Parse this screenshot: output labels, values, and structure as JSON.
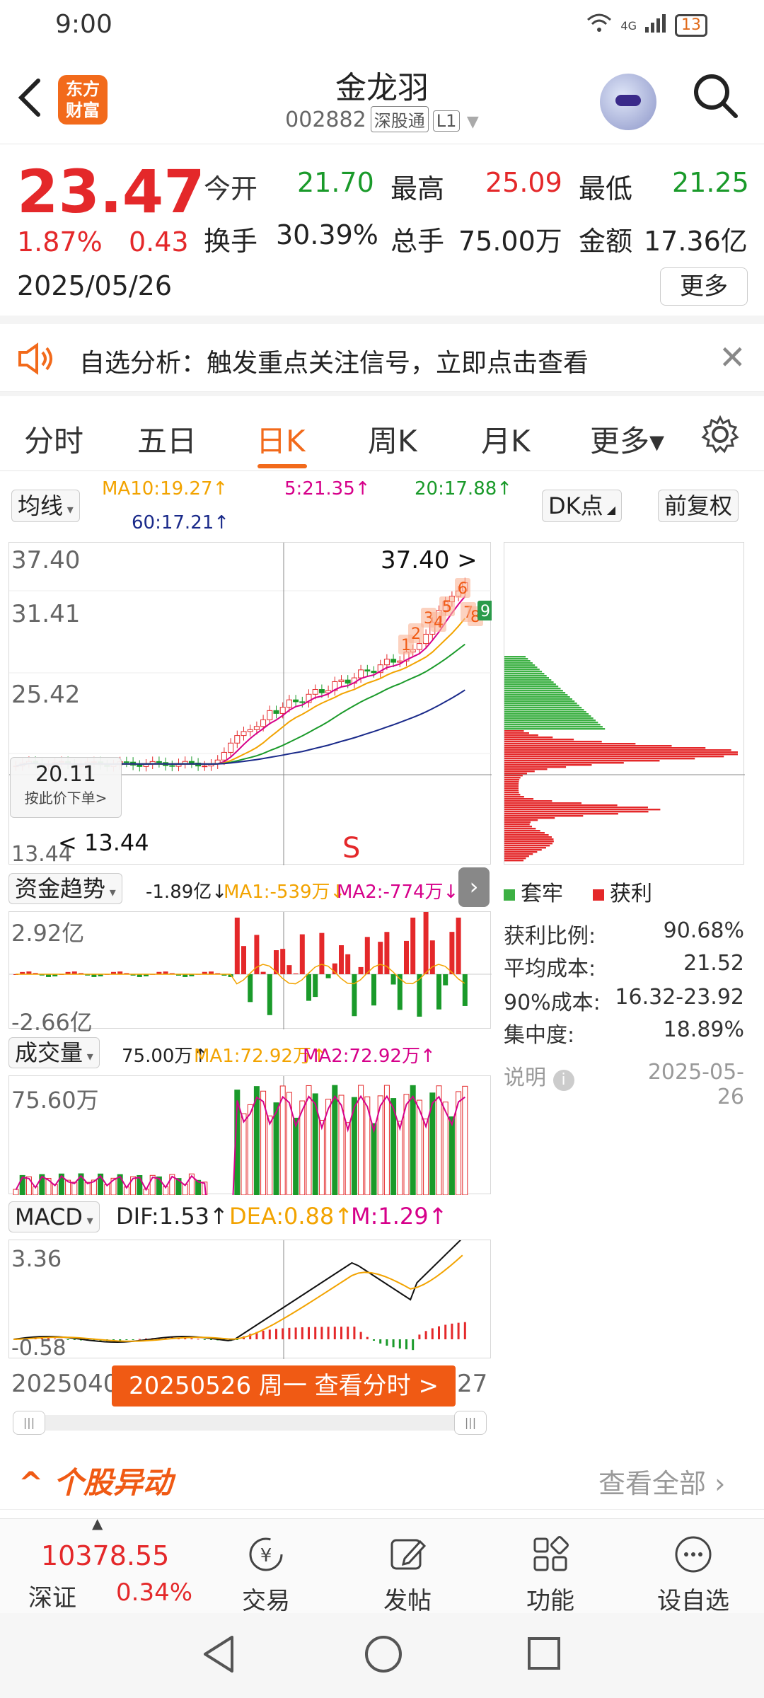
{
  "status": {
    "time": "9:00",
    "network": "4G",
    "battery": "13"
  },
  "header": {
    "title": "金龙羽",
    "code": "002882",
    "tag1": "深股通",
    "tag2": "L1",
    "logo": "东方\n财富"
  },
  "quote": {
    "price": "23.47",
    "change_pct": "1.87%",
    "change": "0.43",
    "date": "2025/05/26",
    "open_label": "今开",
    "open": "21.70",
    "high_label": "最高",
    "high": "25.09",
    "low_label": "最低",
    "low": "21.25",
    "turnover_label": "换手",
    "turnover": "30.39%",
    "volume_label": "总手",
    "volume": "75.00万",
    "amount_label": "金额",
    "amount": "17.36亿",
    "more": "更多"
  },
  "notice": {
    "text": "自选分析：触发重点关注信号，立即点击查看"
  },
  "tabs": [
    "分时",
    "五日",
    "日K",
    "周K",
    "月K",
    "更多▾"
  ],
  "active_tab": "日K",
  "ma": {
    "selector": "均线",
    "ma10": "MA10:19.27↑",
    "ma5": "5:21.35↑",
    "ma20": "20:17.88↑",
    "ma60": "60:17.21↑",
    "dk": "DK点",
    "fq": "前复权"
  },
  "kline": {
    "top_price": "37.40",
    "p2": "31.41",
    "p3": "25.42",
    "bottom": "13.44",
    "max_label": "37.40",
    "min_label": "13.44",
    "crosshair_price": "20.11",
    "crosshair_hint": "按此价下单>",
    "signal_s": "S",
    "numbers": [
      "1",
      "2",
      "3",
      "4",
      "5",
      "6",
      "7",
      "8",
      "9"
    ]
  },
  "chip": {
    "legend_trap": "套牢",
    "legend_profit": "获利",
    "profit_ratio_label": "获利比例:",
    "profit_ratio": "90.68%",
    "avg_cost_label": "平均成本:",
    "avg_cost": "21.52",
    "cost90_label": "90%成本:",
    "cost90": "16.32-23.92",
    "concentration_label": "集中度:",
    "concentration": "18.89%",
    "explain": "说明",
    "date": "2025-05-26"
  },
  "fund": {
    "selector": "资金趋势",
    "value": "-1.89亿↓",
    "ma1": "MA1:-539万↓",
    "ma2": "MA2:-774万↓",
    "top": "2.92亿",
    "bottom": "-2.66亿"
  },
  "vol": {
    "selector": "成交量",
    "value": "75.00万↑",
    "ma1": "MA1:72.92万↑",
    "ma2": "MA2:72.92万↑",
    "top": "75.60万"
  },
  "macd": {
    "selector": "MACD",
    "dif": "DIF:1.53↑",
    "dea": "DEA:0.88↑",
    "m": "M:1.29↑",
    "top": "3.36",
    "bottom": "-0.58"
  },
  "timeline": {
    "start": "2025040",
    "end": "27",
    "banner": "20250526 周一 查看分时 >"
  },
  "movement": {
    "title": "个股异动",
    "view_all": "查看全部"
  },
  "index": {
    "value": "10378.55",
    "name": "深证",
    "pct": "0.34%"
  },
  "bottom_nav": [
    "交易",
    "发帖",
    "功能",
    "设自选"
  ],
  "colors": {
    "up": "#e4282a",
    "down": "#1a9a2a",
    "accent": "#f26a1b",
    "ma5": "#d6008a",
    "ma10": "#f2a300",
    "ma20": "#1a9a2a",
    "ma60": "#1a2a8a"
  }
}
